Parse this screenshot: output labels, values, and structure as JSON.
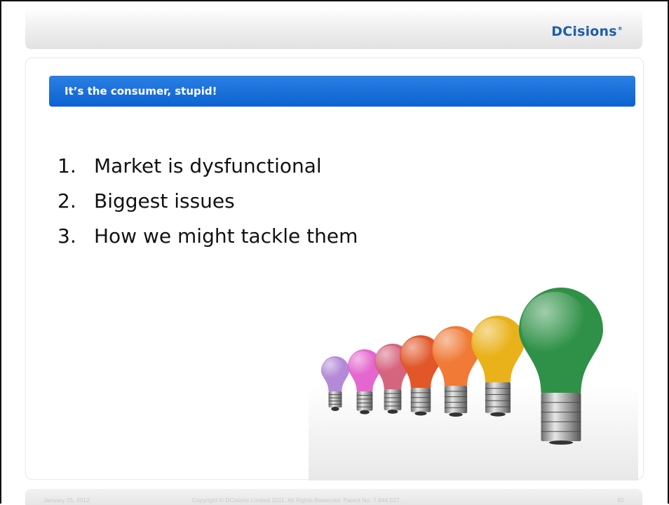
{
  "header": {
    "logo_text": "DCisions",
    "logo_mark": "®"
  },
  "slide": {
    "title": "It’s the consumer, stupid!",
    "items": [
      {
        "num": "1.",
        "text": "Market is dysfunctional"
      },
      {
        "num": "2.",
        "text": "Biggest issues"
      },
      {
        "num": "3.",
        "text": "How we might tackle them"
      }
    ],
    "image": {
      "icon": "lightbulbs-illustration",
      "bulb_colors": [
        "#b48ad8",
        "#e467cf",
        "#d5647f",
        "#e1572a",
        "#f07a36",
        "#e9b21a",
        "#2f9147"
      ]
    }
  },
  "footer": {
    "date": "January 25, 2012",
    "copyright": "Copyright © DCisions Limited 2011, All Rights Reserved. Patent No. 7,844,527.",
    "page": "92"
  },
  "colors": {
    "title_bar": "#1a6ed8",
    "logo": "#1f5fa8"
  }
}
